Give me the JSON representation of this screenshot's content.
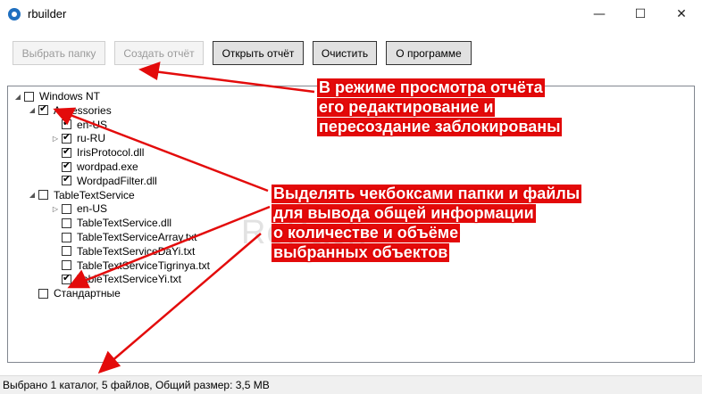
{
  "window": {
    "title": "rbuilder",
    "controls": {
      "minimize": "—",
      "maximize": "☐",
      "close": "✕"
    }
  },
  "toolbar": {
    "choose_folder": "Выбрать папку",
    "create_report": "Создать отчёт",
    "open_report": "Открыть отчёт",
    "clear": "Очистить",
    "about": "О программе"
  },
  "tree": {
    "items": [
      {
        "label": "Windows NT",
        "checked": false,
        "expander": "expanded"
      },
      {
        "label": "Accessories",
        "checked": true,
        "expander": "expanded"
      },
      {
        "label": "en-US",
        "checked": true,
        "expander": "none"
      },
      {
        "label": "ru-RU",
        "checked": true,
        "expander": "collapsed"
      },
      {
        "label": "IrisProtocol.dll",
        "checked": true,
        "expander": "none"
      },
      {
        "label": "wordpad.exe",
        "checked": true,
        "expander": "none"
      },
      {
        "label": "WordpadFilter.dll",
        "checked": true,
        "expander": "none"
      },
      {
        "label": "TableTextService",
        "checked": false,
        "expander": "expanded"
      },
      {
        "label": "en-US",
        "checked": false,
        "expander": "collapsed"
      },
      {
        "label": "TableTextService.dll",
        "checked": false,
        "expander": "none"
      },
      {
        "label": "TableTextServiceArray.txt",
        "checked": false,
        "expander": "none"
      },
      {
        "label": "TableTextServiceDaYi.txt",
        "checked": false,
        "expander": "none"
      },
      {
        "label": "TableTextServiceTigrinya.txt",
        "checked": false,
        "expander": "none"
      },
      {
        "label": "TableTextServiceYi.txt",
        "checked": true,
        "expander": "none"
      },
      {
        "label": "Стандартные",
        "checked": false,
        "expander": "none"
      }
    ]
  },
  "status": {
    "text": "Выбрано 1 каталог, 5 файлов, Общий размер: 3,5 MB"
  },
  "watermark": "RePack",
  "annotations": {
    "top": [
      "В режиме просмотра отчёта",
      "его редактирование и",
      "пересоздание заблокированы"
    ],
    "middle": [
      "Выделять чекбоксами папки и файлы",
      "для вывода общей информации",
      "о количестве и объёме",
      "выбранных объектов"
    ]
  },
  "colors": {
    "annotation": "#e30b0b",
    "tree_border": "#828790",
    "status_bg": "#f0f0f0"
  }
}
